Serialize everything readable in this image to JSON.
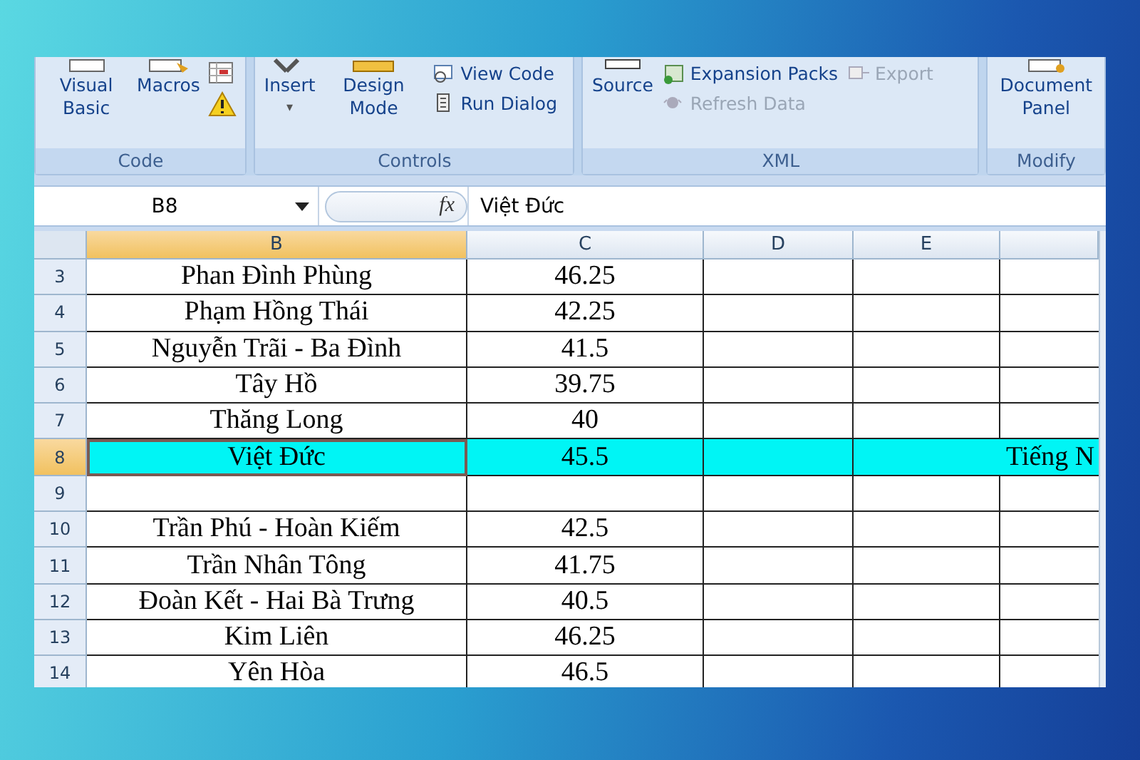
{
  "ribbon": {
    "groups": [
      {
        "label": "Code",
        "items": [
          {
            "kind": "large",
            "label": "Visual Basic"
          },
          {
            "kind": "large",
            "label": "Macros"
          },
          {
            "kind": "icons"
          }
        ]
      },
      {
        "label": "Controls",
        "items": [
          {
            "kind": "large",
            "label": "Insert",
            "caret": "▾"
          },
          {
            "kind": "large",
            "label": "Design Mode"
          },
          {
            "kind": "column",
            "entries": [
              {
                "label": "View Code",
                "disabled": false
              },
              {
                "label": "Run Dialog",
                "disabled": false
              }
            ]
          }
        ]
      },
      {
        "label": "XML",
        "items": [
          {
            "kind": "large",
            "label": "Source"
          },
          {
            "kind": "column",
            "entries": [
              {
                "label": "Expansion Packs",
                "disabled": false
              },
              {
                "label": "Refresh Data",
                "disabled": true
              }
            ]
          },
          {
            "kind": "column",
            "entries": [
              {
                "label": "Export",
                "disabled": true
              }
            ]
          }
        ]
      },
      {
        "label": "Modify",
        "items": [
          {
            "kind": "large",
            "label": "Document Panel"
          }
        ]
      }
    ]
  },
  "formula_bar": {
    "name_box": "B8",
    "function_symbol": "fx",
    "formula": "Việt Đức"
  },
  "sheet": {
    "columns": [
      {
        "label": "B",
        "selected": true
      },
      {
        "label": "C",
        "selected": false
      },
      {
        "label": "D",
        "selected": false
      },
      {
        "label": "E",
        "selected": false
      }
    ],
    "rows": [
      {
        "number": "3",
        "cells": [
          "Phan Đình Phùng",
          "46.25"
        ],
        "selected": false,
        "highlighted": false
      },
      {
        "number": "4",
        "cells": [
          "Phạm Hồng Thái",
          "42.25"
        ],
        "selected": false,
        "highlighted": false
      },
      {
        "number": "5",
        "cells": [
          "Nguyễn Trãi - Ba Đình",
          "41.5"
        ],
        "selected": false,
        "highlighted": false
      },
      {
        "number": "6",
        "cells": [
          "Tây Hồ",
          "39.75"
        ],
        "selected": false,
        "highlighted": false
      },
      {
        "number": "7",
        "cells": [
          "Thăng Long",
          "40"
        ],
        "selected": false,
        "highlighted": false
      },
      {
        "number": "8",
        "cells": [
          "Việt Đức",
          "45.5"
        ],
        "selected": true,
        "highlighted": true,
        "overflow": "Tiếng N"
      },
      {
        "number": "9",
        "selected": false,
        "highlighted": false
      },
      {
        "number": "10",
        "cells": [
          "Trần Phú - Hoàn Kiếm",
          "42.5"
        ],
        "selected": false,
        "highlighted": false
      },
      {
        "number": "11",
        "cells": [
          "Trần Nhân Tông",
          "41.75"
        ],
        "selected": false,
        "highlighted": false
      },
      {
        "number": "12",
        "cells": [
          "Đoàn Kết - Hai Bà Trưng",
          "40.5"
        ],
        "selected": false,
        "highlighted": false
      },
      {
        "number": "13",
        "cells": [
          "Kim Liên",
          "46.25"
        ],
        "selected": false,
        "highlighted": false
      },
      {
        "number": "14",
        "cells": [
          "Yên Hòa",
          "46.5"
        ],
        "selected": false,
        "highlighted": false
      }
    ]
  }
}
